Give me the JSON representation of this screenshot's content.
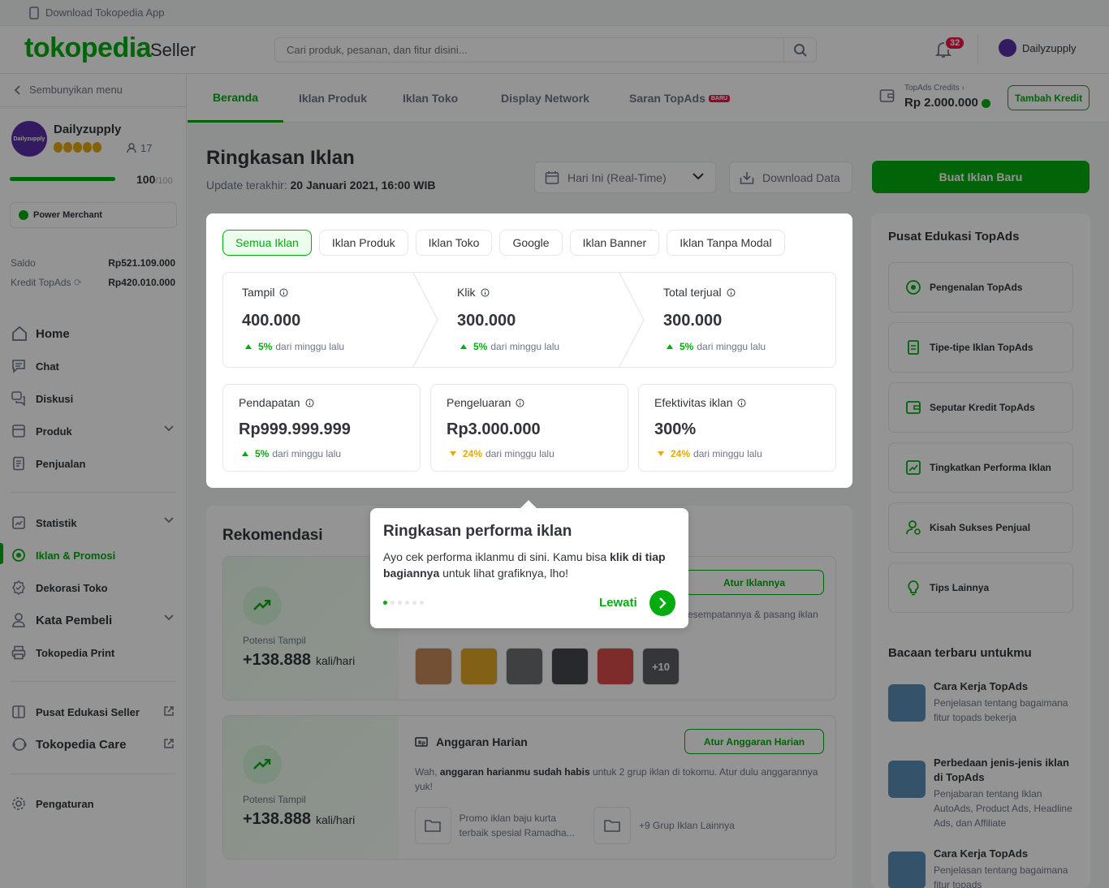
{
  "topbar": {
    "app_link": "Download Tokopedia App"
  },
  "header": {
    "logo": "tokopedia",
    "logo_suffix": "Seller",
    "search_placeholder": "Cari produk, pesanan, dan fitur disini...",
    "notif_count": "32",
    "user": "Dailyzupply"
  },
  "sidebar": {
    "hide_menu": "Sembunyikan menu",
    "shop_name": "Dailyzupply",
    "shop_avatar_text": "Dailyzupply",
    "followers": "17",
    "score": "100",
    "score_max": "/100",
    "score_fraction": 1.0,
    "badge": "Power Merchant",
    "saldo_label": "Saldo",
    "saldo_value": "Rp521.109.000",
    "kredit_label": "Kredit TopAds",
    "kredit_value": "Rp420.010.000",
    "nav": {
      "home": "Home",
      "chat": "Chat",
      "diskusi": "Diskusi",
      "produk": "Produk",
      "penjualan": "Penjualan",
      "statistik": "Statistik",
      "iklan": "Iklan & Promosi",
      "dekorasi": "Dekorasi Toko",
      "kata_pembeli": "Kata Pembeli",
      "print": "Tokopedia Print",
      "edukasi": "Pusat Edukasi Seller",
      "care": "Tokopedia Care",
      "pengaturan": "Pengaturan"
    }
  },
  "tabs": {
    "beranda": "Beranda",
    "iklan_produk": "Iklan Produk",
    "iklan_toko": "Iklan Toko",
    "display": "Display Network",
    "saran": "Saran TopAds",
    "saran_badge": "BARU"
  },
  "credits": {
    "label": "TopAds Credits",
    "value": "Rp 2.000.000",
    "button": "Tambah Kredit"
  },
  "page": {
    "title": "Ringkasan Iklan",
    "update_label": "Update terakhir:",
    "update_value": "20 Januari 2021, 16:00 WIB",
    "date_filter": "Hari Ini (Real-Time)",
    "download": "Download Data",
    "new_ad": "Buat Iklan Baru"
  },
  "summary": {
    "chips": [
      "Semua Iklan",
      "Iklan Produk",
      "Iklan Toko",
      "Google",
      "Iklan Banner",
      "Iklan Tanpa Modal"
    ],
    "funnel": [
      {
        "label": "Tampil",
        "value": "400.000",
        "delta": "5%",
        "delta_text": "dari minggu lalu"
      },
      {
        "label": "Klik",
        "value": "300.000",
        "delta": "5%",
        "delta_text": "dari minggu lalu"
      },
      {
        "label": "Total terjual",
        "value": "300.000",
        "delta": "5%",
        "delta_text": "dari minggu lalu"
      }
    ],
    "metrics": [
      {
        "label": "Pendapatan",
        "value": "Rp999.999.999",
        "delta": "5%",
        "delta_text": "dari minggu lalu"
      },
      {
        "label": "Pengeluaran",
        "value": "Rp3.000.000",
        "delta": "24%",
        "delta_text": "dari minggu lalu"
      },
      {
        "label": "Efektivitas iklan",
        "value": "300%",
        "delta": "24%",
        "delta_text": "dari minggu lalu"
      }
    ]
  },
  "rekomendasi": {
    "title": "Rekomendasi",
    "card1": {
      "potensi_label": "Potensi Tampil",
      "potensi_value": "+138.888",
      "unit": "kali/hari",
      "button": "Atur Iklannya",
      "desc": "esempatannya & pasang iklan",
      "more": "+10"
    },
    "card2": {
      "potensi_label": "Potensi Tampil",
      "potensi_value": "+138.888",
      "unit": "kali/hari",
      "heading": "Anggaran Harian",
      "button": "Atur Anggaran Harian",
      "desc_pre": "Wah, ",
      "desc_bold": "anggaran harianmu sudah habis",
      "desc_post": " untuk 2 grup iklan di tokomu. Atur dulu anggarannya yuk!",
      "folder1": "Promo iklan baju kurta terbaik spesial Ramadha...",
      "folder2": "+9 Grup Iklan Lainnya"
    }
  },
  "edukasi": {
    "title": "Pusat Edukasi TopAds",
    "items": [
      "Pengenalan TopAds",
      "Tipe-tipe Iklan TopAds",
      "Seputar Kredit TopAds",
      "Tingkatkan Performa Iklan",
      "Kisah Sukses Penjual",
      "Tips Lainnya"
    ],
    "reading_title": "Bacaan terbaru untukmu",
    "articles": [
      {
        "title": "Cara Kerja TopAds",
        "desc": "Penjelasan tentang bagaimana fitur topads bekerja"
      },
      {
        "title": "Perbedaan jenis-jenis iklan di TopAds",
        "desc": "Penjabaran tentang Iklan AutoAds, Product Ads, Headline Ads, dan Affiliate"
      },
      {
        "title": "Cara Kerja TopAds",
        "desc": "Penjelasan tentang bagaimana fitur topads"
      }
    ]
  },
  "coachmark": {
    "title": "Ringkasan performa iklan",
    "body_pre": "Ayo cek performa iklanmu di sini. Kamu bisa ",
    "body_bold": "klik di tiap bagiannya",
    "body_post": " untuk lihat grafiknya, lho!",
    "skip": "Lewati",
    "step": 1,
    "total_steps": 6
  },
  "colors": {
    "brand": "#03ac0e",
    "warning": "#e5a910",
    "alert": "#ef144a"
  }
}
